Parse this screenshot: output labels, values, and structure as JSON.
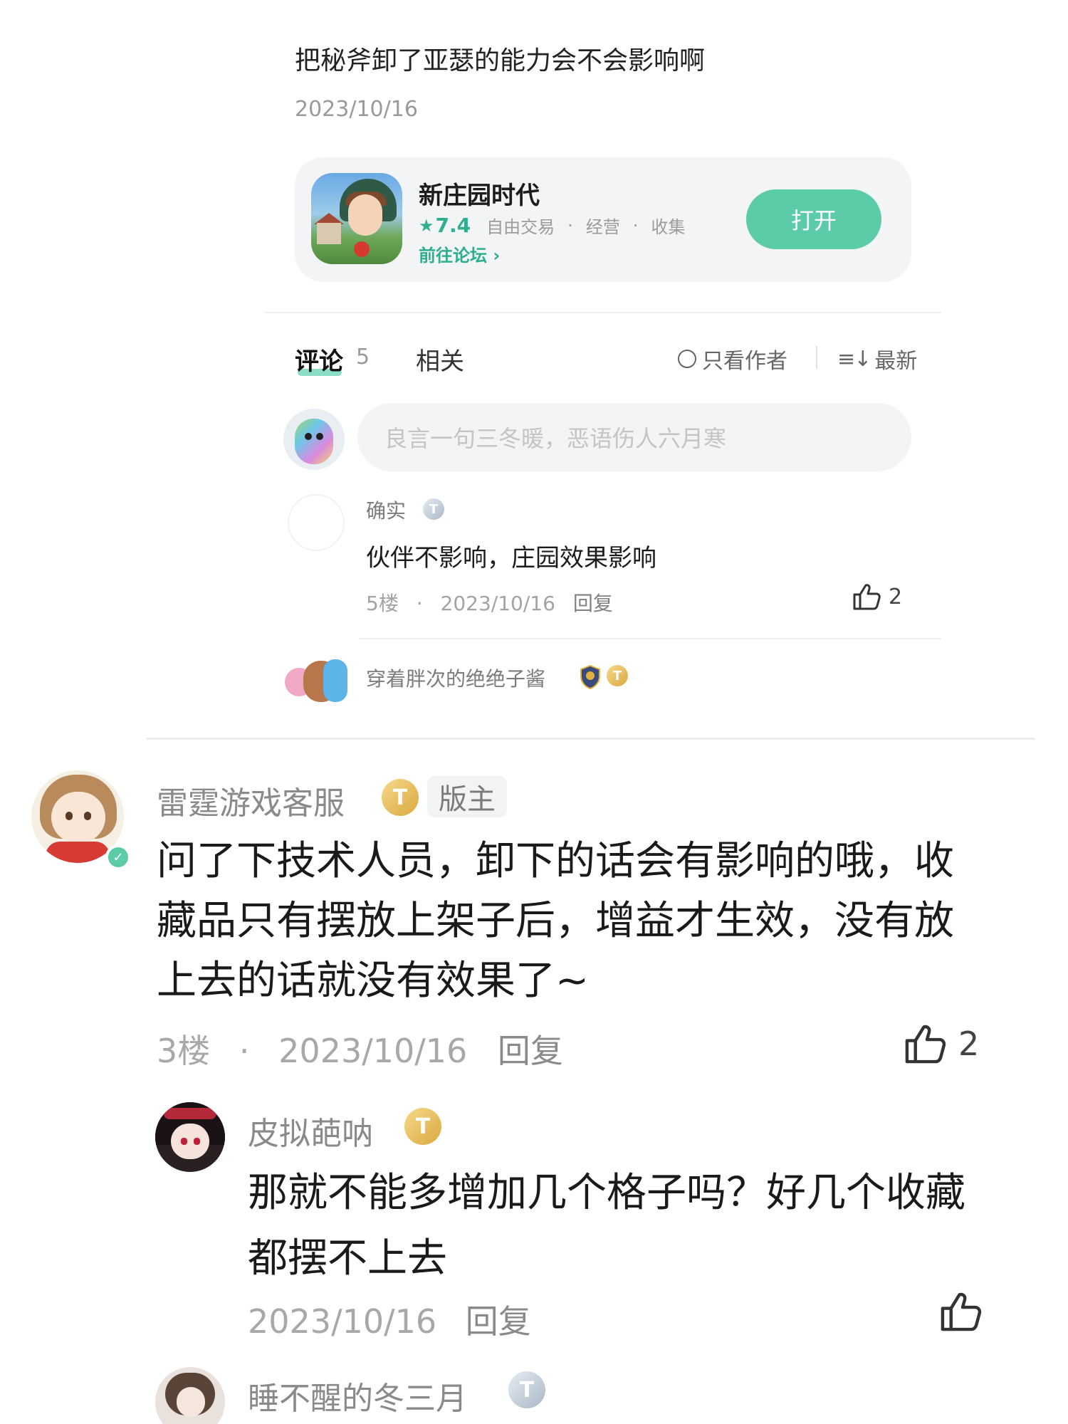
{
  "post": {
    "title": "把秘斧卸了亚瑟的能力会不会影响啊",
    "date": "2023/10/16"
  },
  "app_card": {
    "name": "新庄园时代",
    "rating": "7.4",
    "tags": [
      "自由交易",
      "经营",
      "收集"
    ],
    "forum_link": "前往论坛",
    "open_button": "打开",
    "accent_color": "#5ccba8"
  },
  "tabs": {
    "comments_label": "评论",
    "comments_count": "5",
    "related_label": "相关",
    "author_only": "只看作者",
    "sort": "最新"
  },
  "comment_input": {
    "placeholder": "良言一句三冬暖，恶语伤人六月寒"
  },
  "comments_preview": [
    {
      "user": "确实",
      "level": "T1",
      "text": "伙伴不影响，庄园效果影响",
      "floor": "5楼",
      "date": "2023/10/16",
      "reply": "回复",
      "likes": "2"
    },
    {
      "user": "穿着胖次的绝绝子酱",
      "level": "T8"
    }
  ],
  "main_comment": {
    "user": "雷霆游戏客服",
    "level": "T6",
    "role_tag": "版主",
    "text": "问了下技术人员，卸下的话会有影响的哦，收藏品只有摆放上架子后，增益才生效，没有放上去的话就没有效果了~",
    "floor": "3楼",
    "date": "2023/10/16",
    "reply": "回复",
    "likes": "2",
    "replies": [
      {
        "user": "皮拟葩呐",
        "level": "T4",
        "text": "那就不能多增加几个格子吗？好几个收藏都摆不上去",
        "date": "2023/10/16",
        "reply": "回复"
      },
      {
        "user": "睡不醒的冬三月",
        "level": "T3"
      }
    ]
  },
  "icons": {
    "star": "star-icon",
    "chevron": "chevron-right-icon",
    "like": "thumbs-up-icon",
    "verified": "verified-check-icon",
    "sort": "sort-lines-icon",
    "radio": "radio-circle-icon"
  }
}
